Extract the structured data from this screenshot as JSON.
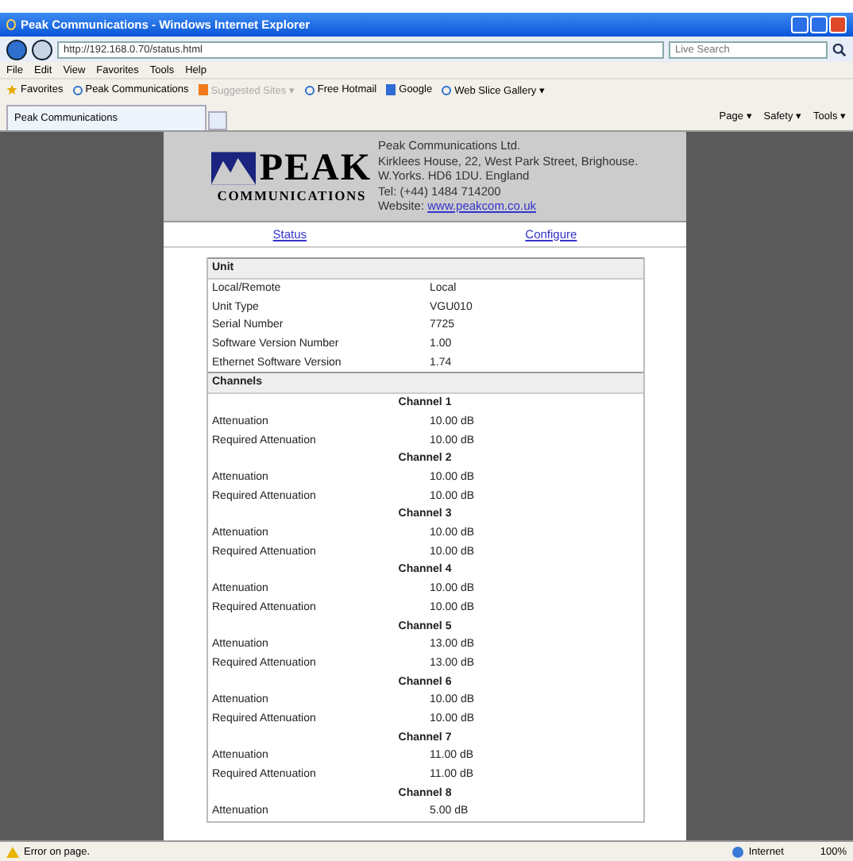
{
  "window": {
    "title": "Peak Communications - Windows Internet Explorer"
  },
  "address_bar": {
    "value": "http://192.168.0.70/status.html"
  },
  "search": {
    "placeholder": "Live Search"
  },
  "menu": [
    "File",
    "Edit",
    "View",
    "Favorites",
    "Tools",
    "Help"
  ],
  "favorites_bar": [
    {
      "label": "Favorites",
      "kind": "star"
    },
    {
      "label": "Peak Communications",
      "kind": "ie"
    },
    {
      "label": "Suggested Sites ▾",
      "kind": "suggest"
    },
    {
      "label": "Free Hotmail",
      "kind": "ie"
    },
    {
      "label": "Google",
      "kind": "google"
    },
    {
      "label": "Web Slice Gallery ▾",
      "kind": "ie"
    }
  ],
  "tabs": [
    {
      "label": "Peak Communications",
      "selected": true
    }
  ],
  "command_bar": [
    "Page ▾",
    "Safety ▾",
    "Tools ▾"
  ],
  "header": {
    "logo_word": "PEAK",
    "logo_sub": "COMMUNICATIONS",
    "lines": [
      "Peak Communications Ltd.",
      "Kirklees House, 22, West Park Street, Brighouse.",
      "W.Yorks. HD6 1DU. England",
      "Tel: (+44) 1484 714200"
    ],
    "website_label": "Website:",
    "website": "www.peakcom.co.uk"
  },
  "nav": [
    "Status",
    "Configure"
  ],
  "unit": {
    "title": "Unit",
    "rows": [
      {
        "label": "Local/Remote",
        "value": "Local"
      },
      {
        "label": "Unit Type",
        "value": "VGU010"
      },
      {
        "label": "Serial Number",
        "value": "7725"
      },
      {
        "label": "Software Version Number",
        "value": "1.00"
      },
      {
        "label": "Ethernet Software Version",
        "value": "1.74"
      }
    ]
  },
  "channels_title": "Channels",
  "channels": [
    {
      "name": "Channel 1",
      "rows": [
        {
          "label": "Attenuation",
          "value": "10.00 dB"
        },
        {
          "label": "Required Attenuation",
          "value": "10.00 dB"
        }
      ]
    },
    {
      "name": "Channel 2",
      "rows": [
        {
          "label": "Attenuation",
          "value": "10.00 dB"
        },
        {
          "label": "Required Attenuation",
          "value": "10.00 dB"
        }
      ]
    },
    {
      "name": "Channel 3",
      "rows": [
        {
          "label": "Attenuation",
          "value": "10.00 dB"
        },
        {
          "label": "Required Attenuation",
          "value": "10.00 dB"
        }
      ]
    },
    {
      "name": "Channel 4",
      "rows": [
        {
          "label": "Attenuation",
          "value": "10.00 dB"
        },
        {
          "label": "Required Attenuation",
          "value": "10.00 dB"
        }
      ]
    },
    {
      "name": "Channel 5",
      "rows": [
        {
          "label": "Attenuation",
          "value": "13.00 dB"
        },
        {
          "label": "Required Attenuation",
          "value": "13.00 dB"
        }
      ]
    },
    {
      "name": "Channel 6",
      "rows": [
        {
          "label": "Attenuation",
          "value": "10.00 dB"
        },
        {
          "label": "Required Attenuation",
          "value": "10.00 dB"
        }
      ]
    },
    {
      "name": "Channel 7",
      "rows": [
        {
          "label": "Attenuation",
          "value": "11.00 dB"
        },
        {
          "label": "Required Attenuation",
          "value": "11.00 dB"
        }
      ]
    },
    {
      "name": "Channel 8",
      "rows": [
        {
          "label": "Attenuation",
          "value": "5.00 dB"
        }
      ]
    }
  ],
  "status_bar": {
    "message": "Error on page.",
    "zone": "Internet",
    "zoom": "100%"
  }
}
